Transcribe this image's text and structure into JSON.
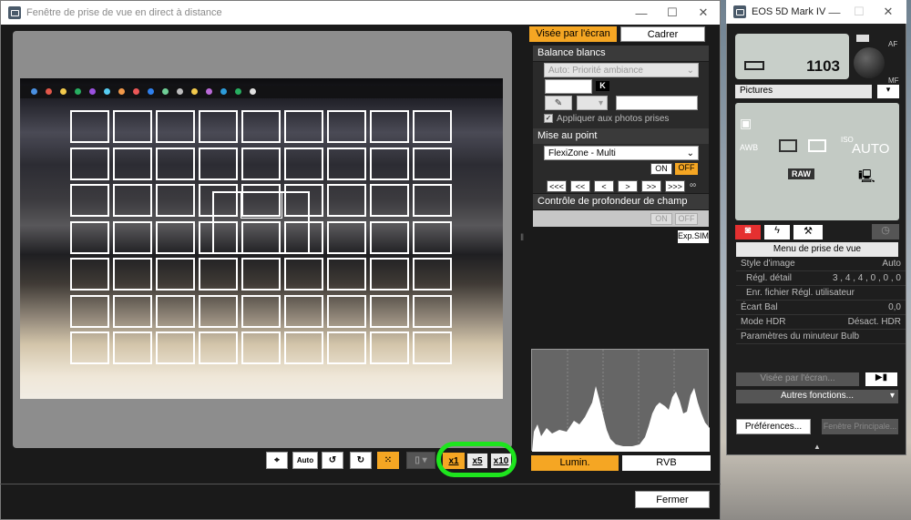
{
  "main_window": {
    "title": "Fenêtre de prise de vue en direct à distance",
    "controls": {
      "minimize": "—",
      "maximize": "☐",
      "close": "✕"
    },
    "close_button": "Fermer",
    "toolbar": {
      "zoom_x1": "x1",
      "zoom_x5": "x5",
      "zoom_x10": "x10",
      "auto_label": "Auto"
    }
  },
  "right_panel": {
    "tab_screen": "Visée par l'écran",
    "tab_frame": "Cadrer",
    "white_balance": {
      "header": "Balance blancs",
      "mode": "Auto: Priorité ambiance",
      "k_label": "K",
      "apply_checkbox": "Appliquer aux photos prises"
    },
    "focus": {
      "header": "Mise au point",
      "mode": "FlexiZone - Multi",
      "on": "ON",
      "off": "OFF",
      "nav": [
        "<<<",
        "<<",
        "<",
        ">",
        ">>",
        ">>>"
      ],
      "infinity": "∞"
    },
    "dof": {
      "header": "Contrôle de profondeur de champ",
      "on": "ON",
      "off": "OFF",
      "exp_sim": "Exp.SIM"
    },
    "hist_buttons": {
      "lumin": "Lumin.",
      "rvb": "RVB"
    }
  },
  "camera_window": {
    "title": "EOS 5D Mark IV",
    "controls": {
      "minimize": "—",
      "maximize": "☐",
      "close": "✕"
    },
    "shots_remaining": "1103",
    "af_label": "AF",
    "mf_label": "MF",
    "folder": "Pictures",
    "settings": {
      "awb": "AWB",
      "iso": "ISO",
      "iso_value": "AUTO",
      "raw": "RAW"
    },
    "menu_title": "Menu de prise de vue",
    "menu_rows": [
      {
        "label": "Style d'image",
        "value": "Auto"
      },
      {
        "label": "Régl. détail",
        "value": "3 , 4 , 4 , 0 , 0 , 0"
      },
      {
        "label": "Enr. fichier Régl. utilisateur",
        "value": ""
      },
      {
        "label": "Écart Bal",
        "value": "0,0"
      },
      {
        "label": "Mode HDR",
        "value": "Désact. HDR"
      },
      {
        "label": "Paramètres du minuteur Bulb",
        "value": ""
      }
    ],
    "liveview_btn": "Visée par l'écran...",
    "other_functions": "Autres fonctions...",
    "preferences": "Préférences...",
    "main_window_btn": "Fenêtre Principale..."
  },
  "colors": {
    "accent": "#f5a623",
    "highlight_ring": "#1ee51e",
    "panel_bg": "#1a1a1a"
  }
}
